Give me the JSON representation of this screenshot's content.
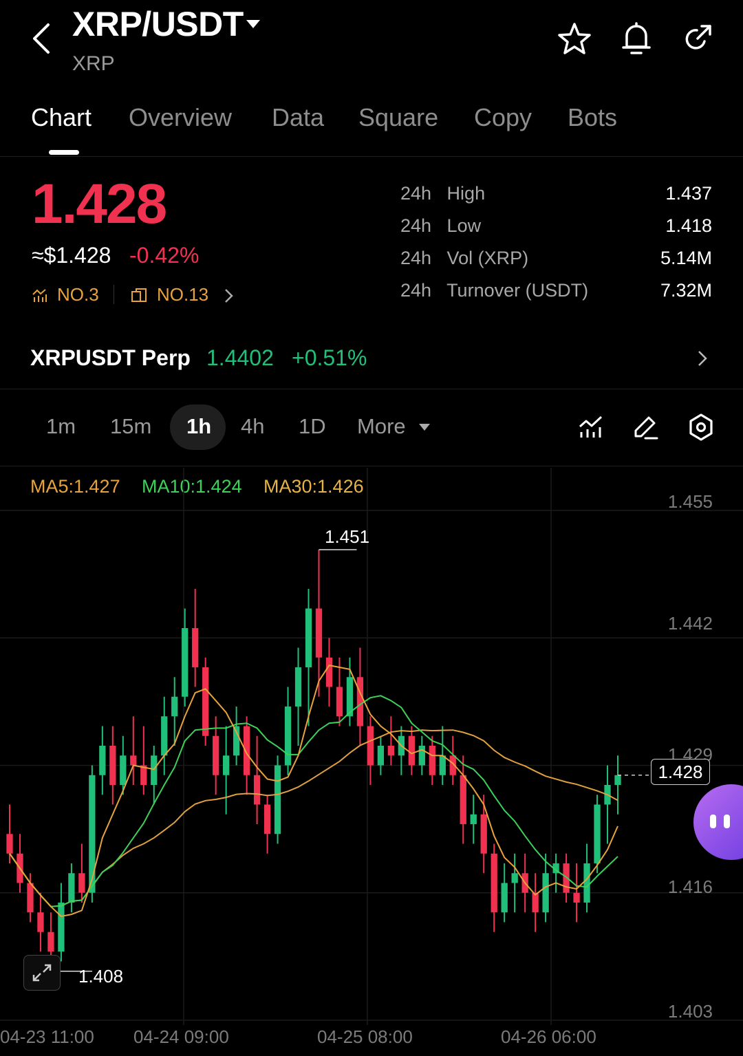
{
  "header": {
    "pair": "XRP/USDT",
    "base": "XRP"
  },
  "tabs": [
    "Chart",
    "Overview",
    "Data",
    "Square",
    "Copy",
    "Bots"
  ],
  "ticker": {
    "price": "1.428",
    "fiat": "≈$1.428",
    "change": "-0.42%",
    "rank1": "NO.3",
    "rank2": "NO.13",
    "stats": [
      {
        "label": "24h   High",
        "value": "1.437"
      },
      {
        "label": "24h   Low",
        "value": "1.418"
      },
      {
        "label": "24h   Vol (XRP)",
        "value": "5.14M"
      },
      {
        "label": "24h   Turnover (USDT)",
        "value": "7.32M"
      }
    ]
  },
  "perp": {
    "name": "XRPUSDT Perp",
    "price": "1.4402",
    "change": "+0.51%"
  },
  "intervals": [
    "1m",
    "15m",
    "1h",
    "4h",
    "1D",
    "More"
  ],
  "indicators": {
    "ma5": "MA5:1.427",
    "ma10": "MA10:1.424",
    "ma30": "MA30:1.426"
  },
  "colors": {
    "up": "#21c07a",
    "down": "#f0314f",
    "ma5": "#e8a33c",
    "ma10": "#3dd15a",
    "ma30": "#e0a040",
    "accent_rank": "#e8a33c"
  },
  "chart_data": {
    "type": "candlestick",
    "y_ticks": [
      "1.455",
      "1.442",
      "1.429",
      "1.416",
      "1.403"
    ],
    "ylim": [
      1.403,
      1.455
    ],
    "x_ticks": [
      "04-23 11:00",
      "04-24 09:00",
      "04-25 08:00",
      "04-26 06:00"
    ],
    "max_label": "1.451",
    "min_label": "1.408",
    "last_price": "1.428",
    "candles": [
      [
        1.422,
        1.425,
        1.419,
        1.42
      ],
      [
        1.42,
        1.422,
        1.416,
        1.417
      ],
      [
        1.417,
        1.418,
        1.413,
        1.414
      ],
      [
        1.414,
        1.416,
        1.41,
        1.412
      ],
      [
        1.412,
        1.414,
        1.408,
        1.41
      ],
      [
        1.41,
        1.417,
        1.409,
        1.415
      ],
      [
        1.415,
        1.419,
        1.414,
        1.418
      ],
      [
        1.418,
        1.421,
        1.415,
        1.416
      ],
      [
        1.416,
        1.429,
        1.415,
        1.428
      ],
      [
        1.428,
        1.433,
        1.426,
        1.431
      ],
      [
        1.431,
        1.433,
        1.425,
        1.427
      ],
      [
        1.427,
        1.432,
        1.426,
        1.43
      ],
      [
        1.43,
        1.434,
        1.427,
        1.429
      ],
      [
        1.429,
        1.433,
        1.426,
        1.427
      ],
      [
        1.427,
        1.431,
        1.425,
        1.43
      ],
      [
        1.43,
        1.436,
        1.428,
        1.434
      ],
      [
        1.434,
        1.438,
        1.431,
        1.436
      ],
      [
        1.436,
        1.445,
        1.435,
        1.443
      ],
      [
        1.443,
        1.447,
        1.437,
        1.439
      ],
      [
        1.439,
        1.44,
        1.431,
        1.432
      ],
      [
        1.432,
        1.434,
        1.426,
        1.428
      ],
      [
        1.428,
        1.433,
        1.424,
        1.43
      ],
      [
        1.43,
        1.435,
        1.429,
        1.433
      ],
      [
        1.433,
        1.434,
        1.426,
        1.428
      ],
      [
        1.428,
        1.432,
        1.423,
        1.425
      ],
      [
        1.425,
        1.426,
        1.42,
        1.422
      ],
      [
        1.422,
        1.43,
        1.421,
        1.429
      ],
      [
        1.429,
        1.437,
        1.428,
        1.435
      ],
      [
        1.435,
        1.441,
        1.431,
        1.439
      ],
      [
        1.439,
        1.447,
        1.433,
        1.445
      ],
      [
        1.445,
        1.451,
        1.436,
        1.44
      ],
      [
        1.44,
        1.442,
        1.435,
        1.437
      ],
      [
        1.437,
        1.44,
        1.433,
        1.434
      ],
      [
        1.434,
        1.44,
        1.433,
        1.438
      ],
      [
        1.438,
        1.441,
        1.431,
        1.433
      ],
      [
        1.433,
        1.434,
        1.427,
        1.429
      ],
      [
        1.429,
        1.432,
        1.428,
        1.431
      ],
      [
        1.431,
        1.434,
        1.429,
        1.43
      ],
      [
        1.43,
        1.433,
        1.428,
        1.432
      ],
      [
        1.432,
        1.433,
        1.428,
        1.429
      ],
      [
        1.429,
        1.432,
        1.428,
        1.431
      ],
      [
        1.431,
        1.432,
        1.427,
        1.428
      ],
      [
        1.428,
        1.433,
        1.427,
        1.43
      ],
      [
        1.43,
        1.432,
        1.427,
        1.428
      ],
      [
        1.428,
        1.43,
        1.421,
        1.423
      ],
      [
        1.423,
        1.426,
        1.421,
        1.424
      ],
      [
        1.424,
        1.426,
        1.418,
        1.42
      ],
      [
        1.42,
        1.421,
        1.412,
        1.414
      ],
      [
        1.414,
        1.419,
        1.413,
        1.417
      ],
      [
        1.417,
        1.42,
        1.414,
        1.418
      ],
      [
        1.418,
        1.42,
        1.414,
        1.416
      ],
      [
        1.416,
        1.418,
        1.412,
        1.414
      ],
      [
        1.414,
        1.42,
        1.413,
        1.418
      ],
      [
        1.418,
        1.42,
        1.416,
        1.419
      ],
      [
        1.419,
        1.42,
        1.415,
        1.416
      ],
      [
        1.416,
        1.419,
        1.413,
        1.415
      ],
      [
        1.415,
        1.421,
        1.414,
        1.419
      ],
      [
        1.419,
        1.426,
        1.418,
        1.425
      ],
      [
        1.425,
        1.429,
        1.421,
        1.427
      ],
      [
        1.427,
        1.43,
        1.424,
        1.428
      ]
    ]
  }
}
